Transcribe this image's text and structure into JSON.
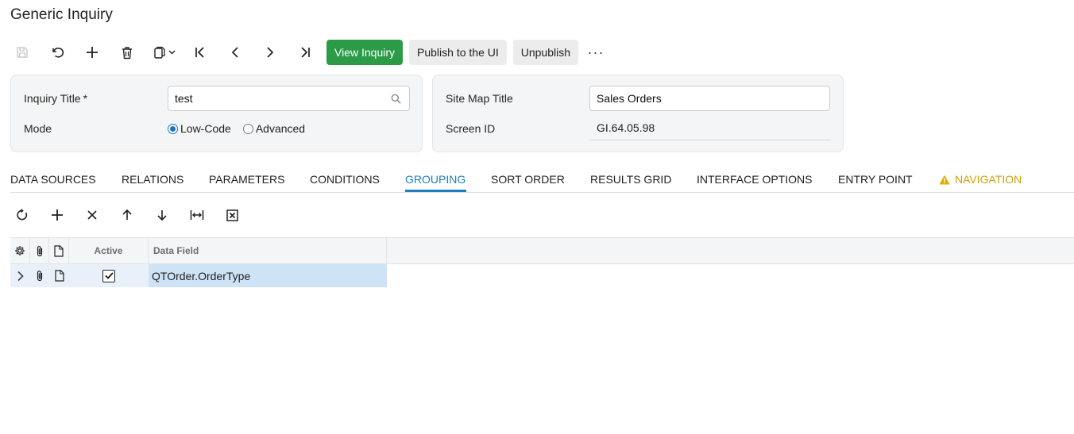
{
  "page": {
    "title": "Generic Inquiry"
  },
  "toolbar": {
    "icons": [
      "save-icon",
      "undo-icon",
      "add-icon",
      "delete-icon",
      "copy-paste-icon",
      "first-record-icon",
      "previous-record-icon",
      "next-record-icon",
      "last-record-icon"
    ],
    "view_inquiry": "View Inquiry",
    "publish": "Publish to the UI",
    "unpublish": "Unpublish",
    "more": "···"
  },
  "form_left": {
    "inquiry_title_label": "Inquiry Title",
    "required_mark": "*",
    "inquiry_title_value": "test",
    "mode_label": "Mode",
    "mode_options": [
      "Low-Code",
      "Advanced"
    ],
    "mode_selected": "Low-Code"
  },
  "form_right": {
    "site_map_title_label": "Site Map Title",
    "site_map_title_value": "Sales Orders",
    "screen_id_label": "Screen ID",
    "screen_id_value": "GI.64.05.98"
  },
  "tabs": [
    {
      "label": "DATA SOURCES"
    },
    {
      "label": "RELATIONS"
    },
    {
      "label": "PARAMETERS"
    },
    {
      "label": "CONDITIONS"
    },
    {
      "label": "GROUPING",
      "active": true
    },
    {
      "label": "SORT ORDER"
    },
    {
      "label": "RESULTS GRID"
    },
    {
      "label": "INTERFACE OPTIONS"
    },
    {
      "label": "ENTRY POINT"
    },
    {
      "label": "NAVIGATION",
      "warning": true
    }
  ],
  "grid_toolbar": {
    "icons": [
      "refresh-icon",
      "add-row-icon",
      "delete-row-icon",
      "move-up-icon",
      "move-down-icon",
      "fit-columns-icon",
      "export-excel-icon"
    ]
  },
  "grid": {
    "columns": {
      "active": "Active",
      "data_field": "Data Field"
    },
    "rows": [
      {
        "active": true,
        "data_field": "QTOrder.OrderType"
      }
    ]
  },
  "colors": {
    "primary_button": "#2c9b48",
    "active_tab": "#1d7fc1",
    "warning": "#d2a100",
    "selected_cell": "#cfe3f6"
  }
}
